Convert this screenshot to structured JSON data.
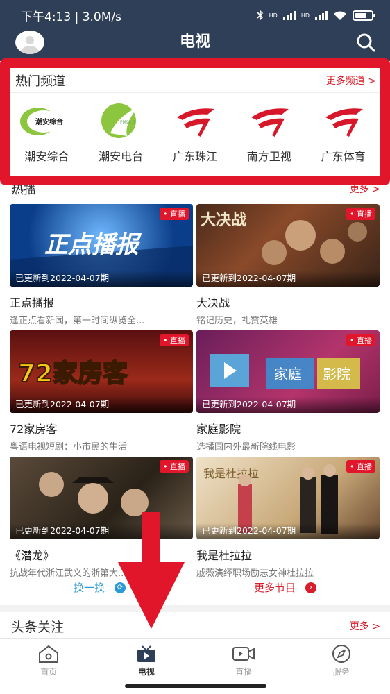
{
  "status_bar": {
    "time_speed": "下午4:13 | 3.0M/s",
    "net_label_1": "HD",
    "net_label_2": "HD"
  },
  "header": {
    "title": "电视"
  },
  "channels": {
    "title": "热门频道",
    "more": "更多频道 >",
    "items": [
      {
        "label": "潮安综合",
        "logo_text": "潮安综合"
      },
      {
        "label": "潮安电台",
        "logo_text": "FM95.3"
      },
      {
        "label": "广东珠江"
      },
      {
        "label": "南方卫视"
      },
      {
        "label": "广东体育"
      }
    ]
  },
  "hot": {
    "title": "热播",
    "more": "更多 >",
    "live_label": "• 直播",
    "items": [
      {
        "title": "正点播报",
        "desc": "逢正点看新闻，第一时间纵览全...",
        "updated": "已更新到2022-04-07期",
        "art": "正点播报"
      },
      {
        "title": "大决战",
        "desc": "铭记历史，礼赞英雄",
        "updated": "已更新到2022-04-07期",
        "art": "大决战"
      },
      {
        "title": "72家房客",
        "desc": "粤语电视短剧：小市民的生活",
        "updated": "已更新到2022-04-07期",
        "art": "72家房客"
      },
      {
        "title": "家庭影院",
        "desc": "选播国内外最新院线电影",
        "updated": "已更新到2022-04-07期",
        "art_1": "家庭",
        "art_2": "影院"
      },
      {
        "title": "《潜龙》",
        "desc": "抗战年代浙江武义的浙第大...",
        "updated": "已更新到2022-04-07期"
      },
      {
        "title": "我是杜拉拉",
        "desc": "戚薇演绎职场励志女神杜拉拉",
        "updated": "已更新到2022-04-07期",
        "art": "我是杜拉拉"
      }
    ],
    "refresh": "换一换",
    "more_programs": "更多节目"
  },
  "headline": {
    "title": "头条关注",
    "more": "更多 >"
  },
  "tabbar": {
    "items": [
      {
        "label": "首页",
        "icon": "home-icon"
      },
      {
        "label": "电视",
        "icon": "tv-icon"
      },
      {
        "label": "直播",
        "icon": "live-icon"
      },
      {
        "label": "服务",
        "icon": "compass-icon"
      }
    ]
  },
  "colors": {
    "header_bg": "#2f3f58",
    "accent_red": "#d81e2a",
    "highlight_red": "#e2162b",
    "refresh_blue": "#2a9bd6"
  }
}
